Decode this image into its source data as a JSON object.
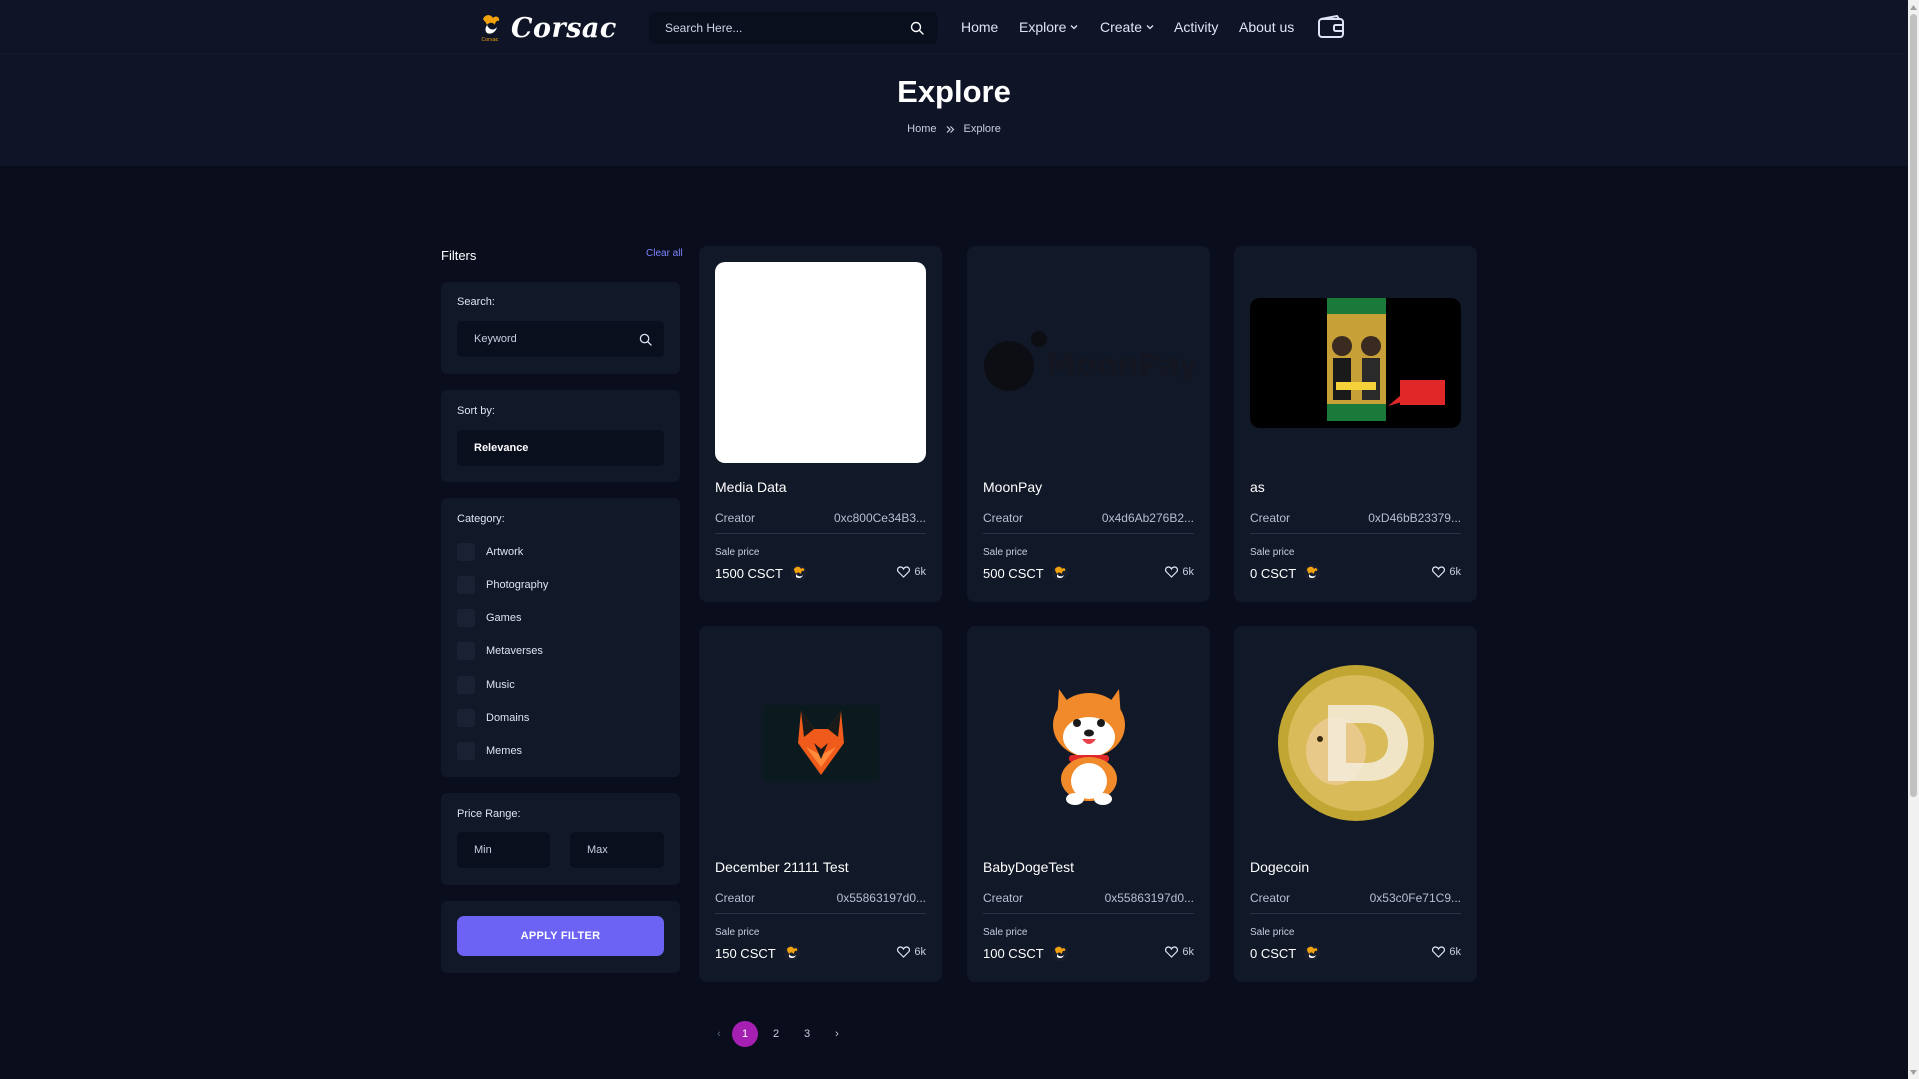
{
  "header": {
    "logo_text": "Corsac",
    "search_placeholder": "Search Here...",
    "nav": {
      "home": "Home",
      "explore": "Explore",
      "create": "Create",
      "activity": "Activity",
      "about": "About us"
    }
  },
  "hero": {
    "title": "Explore",
    "breadcrumb": [
      "Home",
      "Explore"
    ]
  },
  "filters": {
    "title": "Filters",
    "clear_all": "Clear all",
    "search_label": "Search:",
    "search_placeholder": "Keyword",
    "sort_label": "Sort by:",
    "sort_value": "Relevance",
    "category_label": "Category:",
    "categories": [
      "Artwork",
      "Photography",
      "Games",
      "Metaverses",
      "Music",
      "Domains",
      "Memes"
    ],
    "price_label": "Price Range:",
    "min_placeholder": "Min",
    "max_placeholder": "Max",
    "apply_label": "APPLY FILTER"
  },
  "cards": [
    {
      "name": "Media Data",
      "creator_label": "Creator",
      "creator": "0xc800Ce34B3...",
      "sale_label": "Sale price",
      "price": "1500 CSCT",
      "likes": "6k",
      "image": "blank-white"
    },
    {
      "name": "MoonPay",
      "creator_label": "Creator",
      "creator": "0x4d6Ab276B2...",
      "sale_label": "Sale price",
      "price": "500 CSCT",
      "likes": "6k",
      "image": "moonpay-logo"
    },
    {
      "name": "as",
      "creator_label": "Creator",
      "creator": "0xD46bB23379...",
      "sale_label": "Sale price",
      "price": "0 CSCT",
      "likes": "6k",
      "image": "photo-poster"
    },
    {
      "name": "December 21111 Test",
      "creator_label": "Creator",
      "creator": "0x55863197d0...",
      "sale_label": "Sale price",
      "price": "150 CSCT",
      "likes": "6k",
      "image": "fox-logo"
    },
    {
      "name": "BabyDogeTest",
      "creator_label": "Creator",
      "creator": "0x55863197d0...",
      "sale_label": "Sale price",
      "price": "100 CSCT",
      "likes": "6k",
      "image": "shiba-dog"
    },
    {
      "name": "Dogecoin",
      "creator_label": "Creator",
      "creator": "0x53c0Fe71C9...",
      "sale_label": "Sale price",
      "price": "0 CSCT",
      "likes": "6k",
      "image": "dogecoin-coin"
    }
  ],
  "pagination": {
    "prev": "‹",
    "pages": [
      "1",
      "2",
      "3"
    ],
    "active": "1",
    "next": "›"
  },
  "colors": {
    "background": "#0a0e1c",
    "panel": "#111827",
    "accent": "#6c63f5",
    "active_page": "#a51fb3"
  }
}
